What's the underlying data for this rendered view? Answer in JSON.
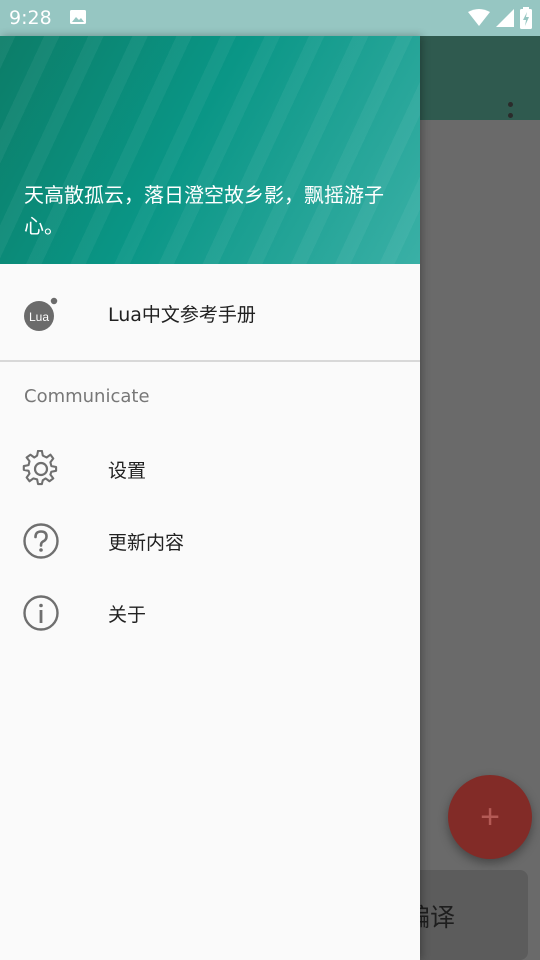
{
  "status_bar": {
    "time": "9:28",
    "icons": [
      "image-icon",
      "wifi-icon",
      "signal-icon",
      "battery-charging-icon"
    ]
  },
  "background_app": {
    "menu_icon": "overflow-menu-icon",
    "fab_icon": "plus-icon",
    "bottom_button_label": "译编译"
  },
  "drawer": {
    "header_quote": "天高散孤云，落日澄空故乡影，飘摇游子心。",
    "account_label": "Lua中文参考手册",
    "logo_text": "Lua",
    "section_title": "Communicate",
    "items": [
      {
        "label": "设置",
        "icon": "gear-icon"
      },
      {
        "label": "更新内容",
        "icon": "help-circle-icon"
      },
      {
        "label": "关于",
        "icon": "info-circle-icon"
      }
    ]
  },
  "colors": {
    "status_bar": "#96c6c2",
    "header_start": "#0c7d68",
    "header_end": "#3ab0a6",
    "fab": "#822b27",
    "scrim": "#6a6a6a"
  }
}
